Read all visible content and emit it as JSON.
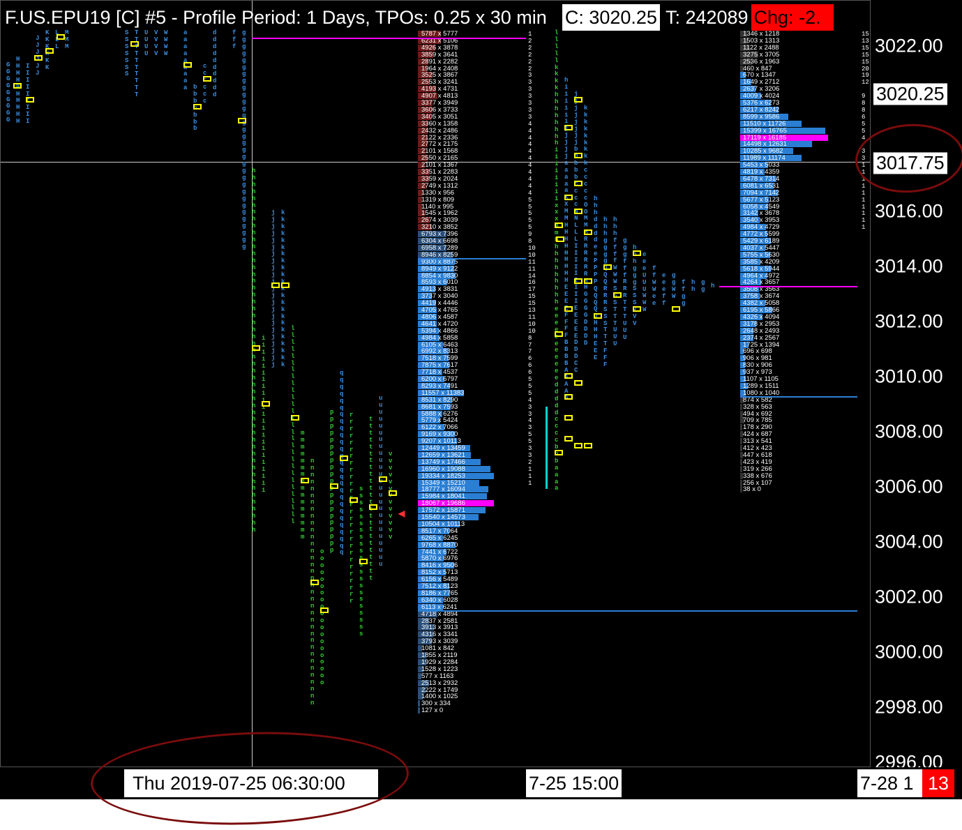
{
  "title": {
    "symbol_text": "F.US.EPU19 [C]  #5 - Profile Period: 1 Days, TPOs: 0.25 x 30 min",
    "close_label": "C: 3020.25",
    "ticks_label": "T: 242089",
    "change_label": "Chg: -2."
  },
  "price_axis": {
    "ticks": [
      "3022.00",
      "3020.25",
      "3017.75",
      "3016.00",
      "3014.00",
      "3012.00",
      "3010.00",
      "3008.00",
      "3006.00",
      "3004.00",
      "3002.00",
      "3000.00",
      "2998.00",
      "2996.00"
    ],
    "current_price": "3020.25",
    "hover_price": "3017.75"
  },
  "time_axis": {
    "hover_time": "Thu 2019-07-25  06:30:00",
    "label_1": "7-25  15:00",
    "label_2": "7-28  1",
    "badge": "13"
  },
  "colors": {
    "background": "#000000",
    "volume_bar": "#2a7fd4",
    "poc": "#ff00ff",
    "value_area_line": "#2a7fd4",
    "tpo_blue": "#3a8fe0",
    "tpo_green": "#33cc33",
    "tpo_yellow": "#ffff00",
    "annotation": "#7a0c0c"
  },
  "profile_1_volume": [
    "5787 x 5777",
    "6231 x 5106",
    "4926 x 3878",
    "3859 x 3641",
    "2891 x 2282",
    "1964 x 2408",
    "3525 x 3867",
    "2553 x 3241",
    "4193 x 4731",
    "4907 x 4813",
    "3377 x 3949",
    "3606 x 3733",
    "3405 x 3051",
    "3360 x 1358",
    "2432 x 2486",
    "2122 x 2336",
    "2772 x 2175",
    "2101 x 1568",
    "2550 x 2165",
    "2101 x 1367",
    "3351 x 2283",
    "3359 x 2024",
    "2749 x 1312",
    "1330 x 956",
    "1319 x 809",
    "1140 x 995",
    "1545 x 1962",
    "2674 x 3039",
    "3210 x 3852",
    "6793 x 7396",
    "6304 x 6698",
    "6958 x 7289",
    "8946 x 8259",
    "9300 x 8875",
    "8949 x 9122",
    "8854 x 9830",
    "8593 x 6010",
    "4913 x 3831",
    "3737 x 3040",
    "4419 x 4446",
    "4705 x 4765",
    "4806 x 4587",
    "4641 x 4720",
    "5394 x 4866",
    "4984 x 5858",
    "6105 x 6463",
    "6992 x 8313",
    "7518 x 7599",
    "7875 x 7617",
    "7718 x 4537",
    "6200 x 6797",
    "8293 x 7491",
    "11557 x 11383",
    "8531 x 8290",
    "8681 x 7593",
    "5888 x 6276",
    "5779 x 5424",
    "6122 x 7066",
    "9169 x 9300",
    "9207 x 10113",
    "12449 x 13459",
    "12659 x 13621",
    "13749 x 17466",
    "16960 x 19088",
    "19334 x 18253",
    "15349 x 15210",
    "18777 x 16094",
    "15984 x 18041",
    "18067 x 19686",
    "17572 x 15871",
    "15540 x 14573",
    "10504 x 10113",
    "8517 x 7064",
    "6265 x 6245",
    "9768 x 8870",
    "7441 x 6722",
    "5870 x 6976",
    "8416 x 9506",
    "8152 x 5713",
    "6156 x 5489",
    "7512 x 8123",
    "8186 x 7765",
    "6340 x 6028",
    "6113 x 6241",
    "4718 x 4894",
    "2837 x 2581",
    "3913 x 3913",
    "4316 x 3341",
    "3793 x 3039",
    "1081 x 842",
    "1855 x 2119",
    "1929 x 2284",
    "1528 x 1223",
    "577 x 1163",
    "2513 x 2932",
    "2222 x 1749",
    "1400 x 1025",
    "300 x 334",
    "127 x 0"
  ],
  "profile_1_poc": "18067 x 19686",
  "profile_2_volume": [
    "1346 x 1218",
    "1503 x 1313",
    "1122 x 2488",
    "3275 x 3705",
    "2536 x 1963",
    "460 x 847",
    "670 x 1347",
    "1649 x 2712",
    "2637 x 3206",
    "4009 x 4024",
    "5376 x 6273",
    "6217 x 8242",
    "8599 x 9586",
    "11510 x 11726",
    "15399 x 16765",
    "17119 x 16185",
    "14498 x 12631",
    "10285 x 9682",
    "11989 x 11174",
    "5453 x 5033",
    "4819 x 4359",
    "6478 x 7314",
    "6081 x 6531",
    "7094 x 7142",
    "5677 x 5123",
    "6058 x 4549",
    "3142 x 3678",
    "3540 x 3953",
    "4984 x 4729",
    "4772 x 5599",
    "5429 x 6189",
    "4037 x 5447",
    "5755 x 5630",
    "3585 x 4209",
    "5618 x 5944",
    "4964 x 4972",
    "4264 x 3657",
    "3508 x 3563",
    "3758 x 3674",
    "4382 x 5058",
    "6195 x 5866",
    "4326 x 4094",
    "3178 x 2953",
    "2648 x 2493",
    "2374 x 2567",
    "1725 x 1394",
    "696 x 698",
    "906 x 981",
    "830 x 906",
    "937 x 973",
    "1107 x 1105",
    "1289 x 1511",
    "1080 x 1040",
    "874 x 582",
    "328 x 563",
    "494 x 692",
    "709 x 785",
    "178 x 290",
    "424 x 687",
    "313 x 541",
    "412 x 423",
    "447 x 618",
    "423 x 419",
    "319 x 266",
    "338 x 676",
    "256 x 107",
    "38 x 0"
  ],
  "profile_2_poc": "17119 x 16185",
  "profile_2_counts": [
    "15",
    "13",
    "15",
    "15",
    "15",
    "20",
    "19",
    "12",
    "",
    "9",
    "8",
    "8",
    "6",
    "5",
    "5",
    "4",
    "",
    "3",
    "3",
    "1",
    "1",
    "1",
    "1",
    "1",
    "1",
    "1",
    "1",
    "1",
    "1"
  ],
  "profile_1_counts": [
    "1",
    "2",
    "2",
    "2",
    "2",
    "2",
    "3",
    "3",
    "3",
    "3",
    "3",
    "3",
    "3",
    "4",
    "4",
    "4",
    "4",
    "4",
    "4",
    "4",
    "4",
    "4",
    "4",
    "4",
    "5",
    "5",
    "5",
    "5",
    "5",
    "9",
    "8",
    "10",
    "10",
    "11",
    "11",
    "14",
    "16",
    "17",
    "15",
    "15",
    "13",
    "11",
    "10",
    "10",
    "8",
    "7",
    "7",
    "6",
    "6",
    "6",
    "5",
    "5",
    "5",
    "4",
    "3",
    "3",
    "4",
    "3",
    "5",
    "5",
    "3",
    "3",
    "2",
    "1",
    "1",
    "1"
  ]
}
